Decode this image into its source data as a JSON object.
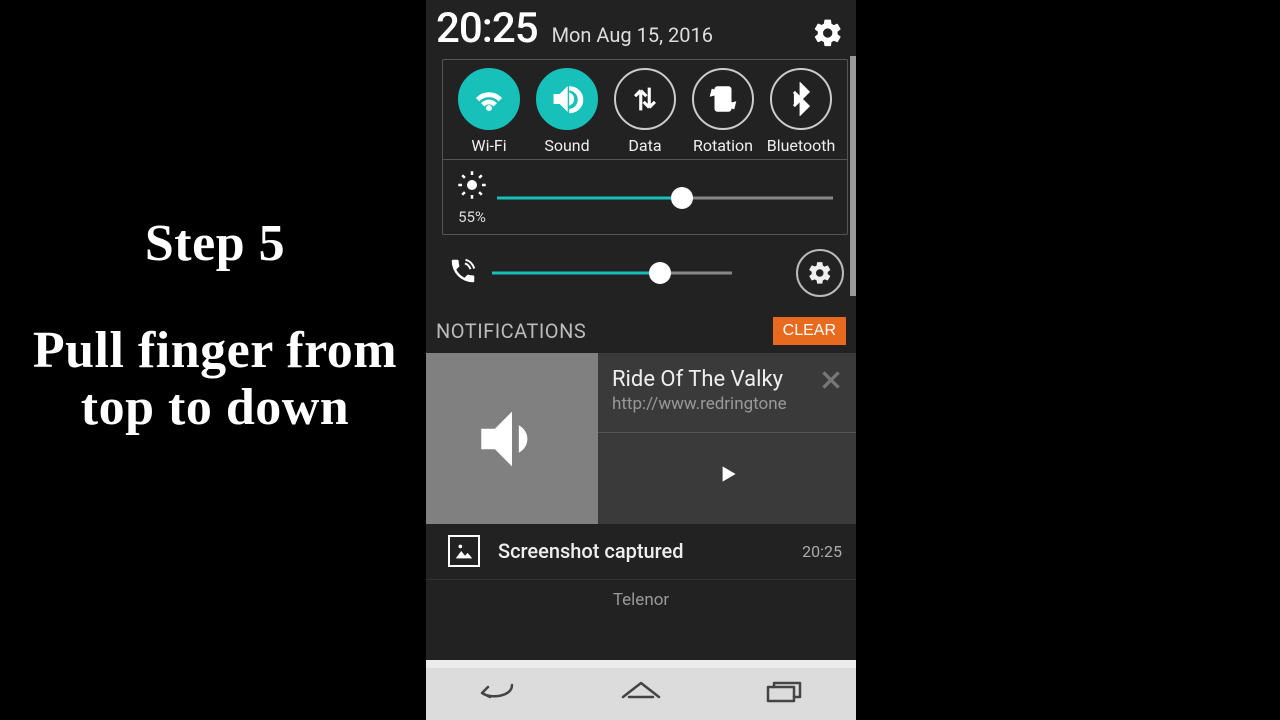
{
  "instruction": {
    "title": "Step 5",
    "body": "Pull finger from top to down"
  },
  "status": {
    "time": "20:25",
    "date": "Mon Aug 15, 2016"
  },
  "toggles": [
    {
      "label": "Wi-Fi",
      "on": true
    },
    {
      "label": "Sound",
      "on": true
    },
    {
      "label": "Data",
      "on": false
    },
    {
      "label": "Rotation",
      "on": false
    },
    {
      "label": "Bluetooth",
      "on": false
    }
  ],
  "brightness": {
    "percent_label": "55%",
    "value": 55
  },
  "ringer": {
    "value": 70
  },
  "notifications": {
    "header": "NOTIFICATIONS",
    "clear_label": "CLEAR",
    "media": {
      "title": "Ride Of The Valky",
      "subtitle": "http://www.redringtone"
    },
    "screenshot": {
      "title": "Screenshot captured",
      "time": "20:25"
    },
    "carrier": "Telenor"
  }
}
